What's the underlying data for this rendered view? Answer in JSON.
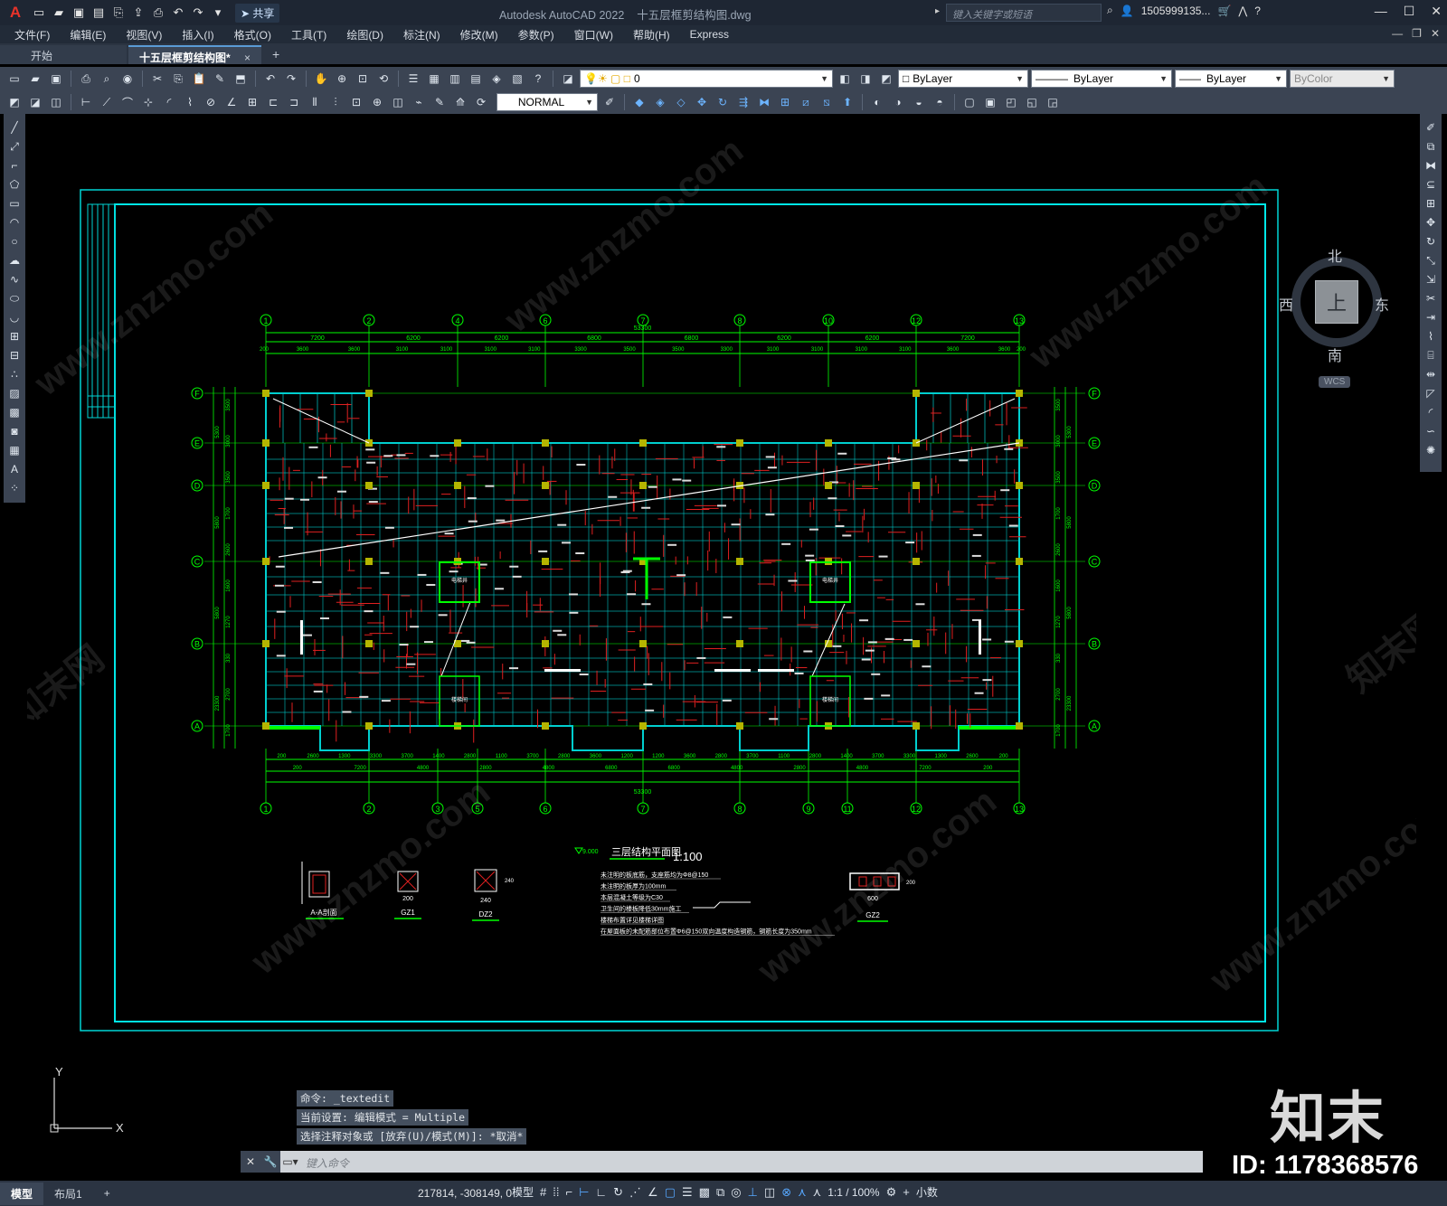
{
  "titlebar": {
    "logo": "A",
    "share": "共享",
    "app": "Autodesk AutoCAD 2022",
    "file": "十五层框剪结构图.dwg",
    "search_placeholder": "键入关键字或短语",
    "user": "1505999135...",
    "help": "?"
  },
  "menu": [
    "文件(F)",
    "编辑(E)",
    "视图(V)",
    "插入(I)",
    "格式(O)",
    "工具(T)",
    "绘图(D)",
    "标注(N)",
    "修改(M)",
    "参数(P)",
    "窗口(W)",
    "帮助(H)",
    "Express"
  ],
  "tabs": {
    "start": "开始",
    "active": "十五层框剪结构图*",
    "close": "×",
    "add": "+"
  },
  "toolbar": {
    "layer": "0",
    "color": "ByLayer",
    "linetype": "ByLayer",
    "lineweight": "ByLayer",
    "plotstyle": "ByColor",
    "dimstyle": "NORMAL"
  },
  "viewcube": {
    "north": "北",
    "south": "南",
    "east": "东",
    "west": "西",
    "face": "上",
    "wcs": "WCS"
  },
  "ucs": {
    "x": "X",
    "y": "Y"
  },
  "drawing": {
    "grid_top": [
      "1",
      "2",
      "4",
      "6",
      "7",
      "8",
      "10",
      "12",
      "13"
    ],
    "grid_bottom": [
      "1",
      "2",
      "3",
      "5",
      "6",
      "7",
      "8",
      "9",
      "11",
      "12",
      "13"
    ],
    "grid_rows": [
      "F",
      "E",
      "D",
      "C",
      "B",
      "A"
    ],
    "dim_total": "53300",
    "dims_top_row1": [
      "7200",
      "6200",
      "6200",
      "6800",
      "6800",
      "6200",
      "6200",
      "7200"
    ],
    "dims_top_row2": [
      "200",
      "3600",
      "3600",
      "3100",
      "3100",
      "3100",
      "3100",
      "3300",
      "3500",
      "3500",
      "3300",
      "3100",
      "3100",
      "3100",
      "3100",
      "3600",
      "3600",
      "200"
    ],
    "dims_bottom_row1": [
      "200",
      "2600",
      "1300",
      "3300",
      "3700",
      "1400",
      "2800",
      "1100",
      "3700",
      "2800",
      "3600",
      "1200",
      "1200",
      "3600",
      "2800",
      "3700",
      "1100",
      "2800",
      "1400",
      "3700",
      "3300",
      "1300",
      "2600",
      "200"
    ],
    "dims_bottom_row2": [
      "200",
      "7200",
      "4800",
      "2800",
      "4800",
      "6800",
      "6800",
      "4800",
      "2800",
      "4800",
      "7200",
      "200"
    ],
    "dims_left": [
      "3500",
      "3000",
      "3500",
      "1700",
      "2600",
      "1600",
      "1270",
      "330",
      "2700",
      "1700"
    ],
    "dims_left_total": [
      "5300",
      "5800",
      "5800",
      "23300"
    ],
    "plan_title": "三层结构平面图",
    "plan_scale": "1:100",
    "elev": "9.000",
    "notes": [
      "未注明的板底筋，支座筋均为Φ8@150",
      "未注明的板厚为100mm",
      "本层混凝土等级为C30",
      "卫生间的楼板降低30mm施工",
      "楼梯布置详见楼梯详图",
      "在屋面板的未配筋部位布置Φ6@150双向温度构造钢筋，钢筋长度为350mm"
    ],
    "details": [
      "A-A剖面",
      "GZ1",
      "DZ2",
      "GZ2"
    ],
    "detail_dims": [
      "200",
      "240",
      "240",
      "600",
      "200"
    ],
    "room_labels": [
      "电梯井",
      "电梯井",
      "楼梯间",
      "楼梯间"
    ]
  },
  "command": {
    "history": [
      "命令: _textedit",
      "当前设置: 编辑模式 = Multiple",
      "选择注释对象或 [放弃(U)/模式(M)]: *取消*"
    ],
    "placeholder": "键入命令"
  },
  "status": {
    "model_tab": "模型",
    "layout_tab": "布局1",
    "add_tab": "+",
    "coords": "217814, -308149, 0",
    "model_btn": "模型",
    "scale": "1:1 / 100%",
    "units": "小数"
  },
  "watermark": {
    "brand": "知末",
    "id": "ID: 1178368576",
    "site": "www.znzmo.com",
    "cn": "知末网"
  }
}
